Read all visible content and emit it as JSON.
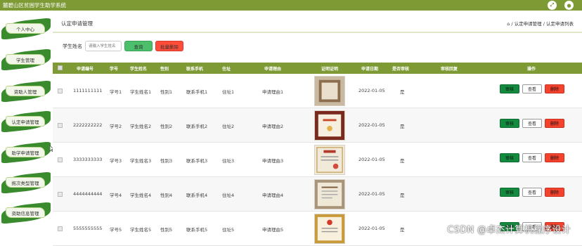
{
  "app": {
    "title": "麓碧山区贫困学生助学系统"
  },
  "topbar": {
    "icons": [
      "fullscreen-icon",
      "user-icon"
    ]
  },
  "sidebar": {
    "items": [
      {
        "label": "个人中心"
      },
      {
        "label": "学生管理"
      },
      {
        "label": "资助人管理"
      },
      {
        "label": "认定申请管理"
      },
      {
        "label": "助学申请管理"
      },
      {
        "label": "拖次类型管理"
      },
      {
        "label": "资助信息管理"
      }
    ]
  },
  "page": {
    "title": "认定申请管理",
    "breadcrumb": "⌂ / 认定申请管理 / 认定申请列表"
  },
  "search": {
    "label": "学生姓名",
    "placeholder": "请输入学生姓名",
    "query_label": "查询",
    "batch_delete_label": "批量删除"
  },
  "table": {
    "columns": [
      "申请编号",
      "学号",
      "学生姓名",
      "性别",
      "联系手机",
      "住址",
      "申请理由",
      "证明证明",
      "申请日期",
      "是否审核",
      "审核回复",
      "操作"
    ],
    "rows": [
      {
        "id": "1111111111",
        "sno": "学号1",
        "name": "学生姓名1",
        "gender": "性别1",
        "phone": "联系手机1",
        "addr": "住址1",
        "reason": "申请理由1",
        "date": "2022-01-05",
        "audited": "是",
        "reply": ""
      },
      {
        "id": "2222222222",
        "sno": "学号2",
        "name": "学生姓名2",
        "gender": "性别2",
        "phone": "联系手机2",
        "addr": "住址2",
        "reason": "申请理由2",
        "date": "2022-01-05",
        "audited": "是",
        "reply": ""
      },
      {
        "id": "3333333333",
        "sno": "学号3",
        "name": "学生姓名3",
        "gender": "性别3",
        "phone": "联系手机3",
        "addr": "住址3",
        "reason": "申请理由3",
        "date": "2022-01-05",
        "audited": "是",
        "reply": ""
      },
      {
        "id": "4444444444",
        "sno": "学号4",
        "name": "学生姓名4",
        "gender": "性别4",
        "phone": "联系手机4",
        "addr": "住址4",
        "reason": "申请理由4",
        "date": "2022-01-05",
        "audited": "是",
        "reply": ""
      },
      {
        "id": "5555555555",
        "sno": "学号5",
        "name": "学生姓名5",
        "gender": "性别5",
        "phone": "联系手机5",
        "addr": "住址5",
        "reason": "申请理由5",
        "date": "2022-01-05",
        "audited": "是",
        "reply": ""
      }
    ],
    "actions": {
      "audit": "审核",
      "view": "查看",
      "delete": "删除"
    }
  },
  "watermark": "CSDN @卓杰计算机程序设计",
  "colors": {
    "topbar": "#7e9a35",
    "menu": "#3a8a2e",
    "audit": "#138a3e",
    "delete": "#f5422d",
    "query": "#4cbf6a"
  }
}
